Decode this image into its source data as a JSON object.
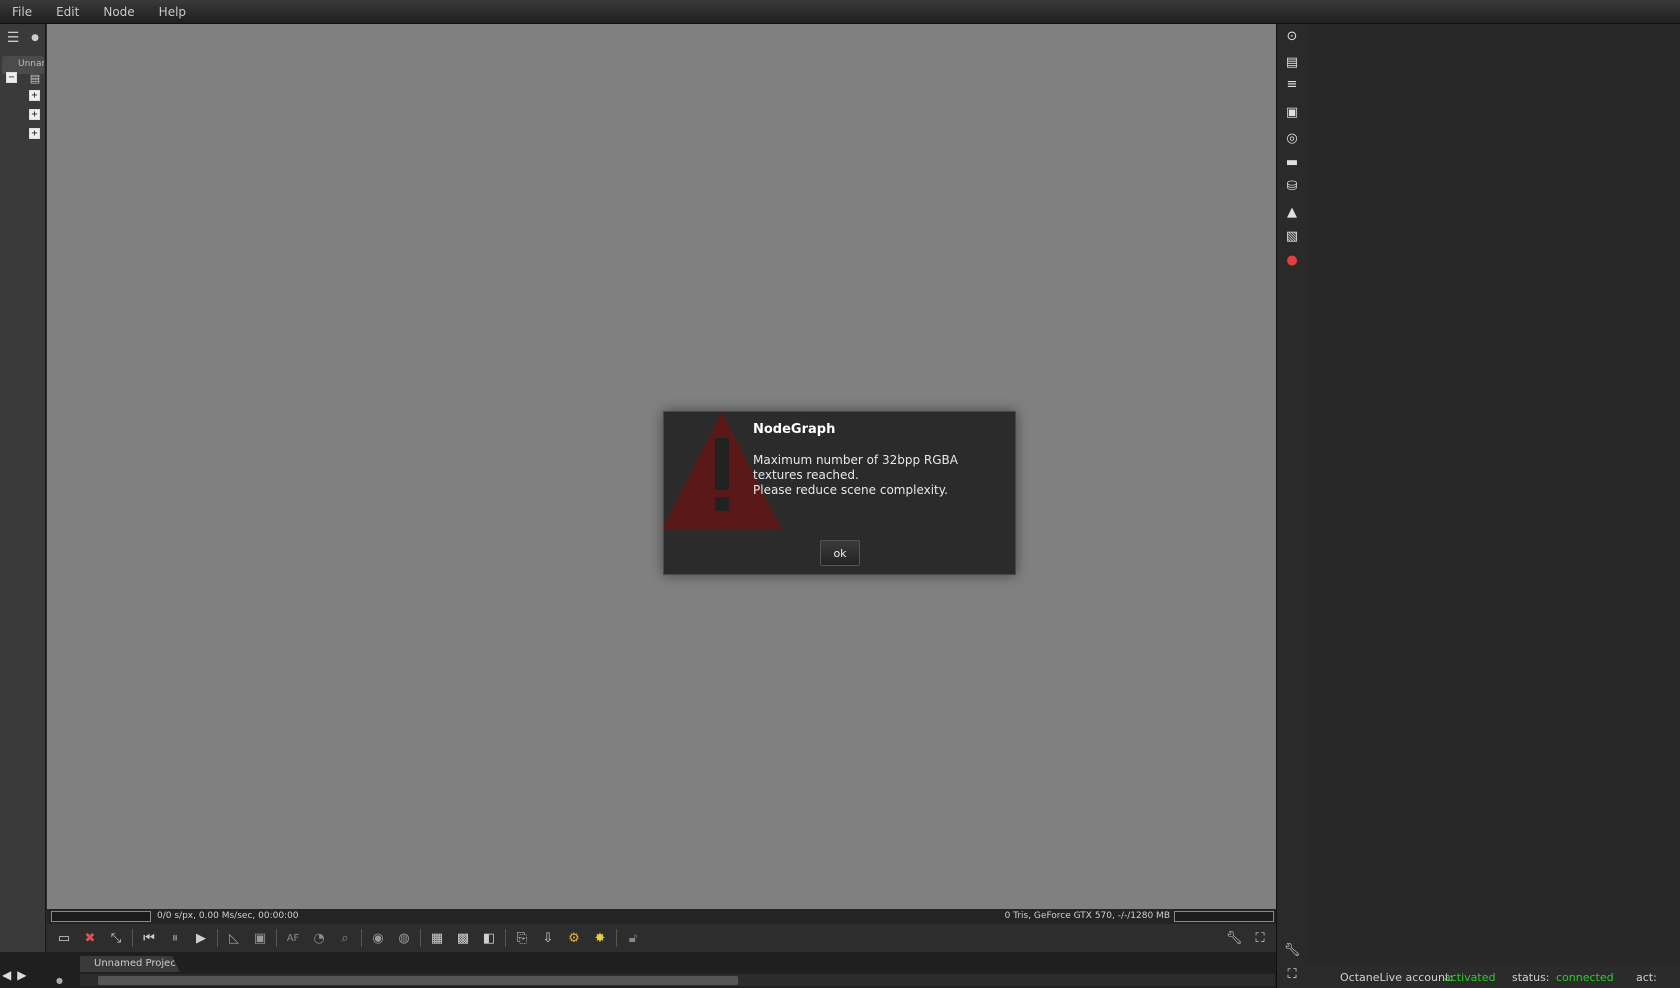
{
  "menu": [
    "File",
    "Edit",
    "Node",
    "Help"
  ],
  "left_panel": {
    "tab_label": "Unnamed Project",
    "tree_collapse": "−",
    "tree_expand": "+"
  },
  "status": {
    "left_text": "0/0 s/px, 0.00 Ms/sec, 00:00:00",
    "right_text": "0 Tris, GeForce GTX 570, -/-/1280 MB"
  },
  "project_tab": "Unnamed Project",
  "dialog": {
    "title": "NodeGraph",
    "message_line1": "Maximum number of 32bpp RGBA textures reached.",
    "message_line2": "Please reduce scene complexity.",
    "ok_label": "ok",
    "warning_color": "#5a1818"
  },
  "account": {
    "account_label": "OctaneLive account:",
    "account_value": "activated",
    "status_label": "status:",
    "status_value": "connected",
    "act_label": "act:"
  },
  "colors": {
    "viewport_bg": "#808080",
    "accent_green": "#28d028"
  }
}
